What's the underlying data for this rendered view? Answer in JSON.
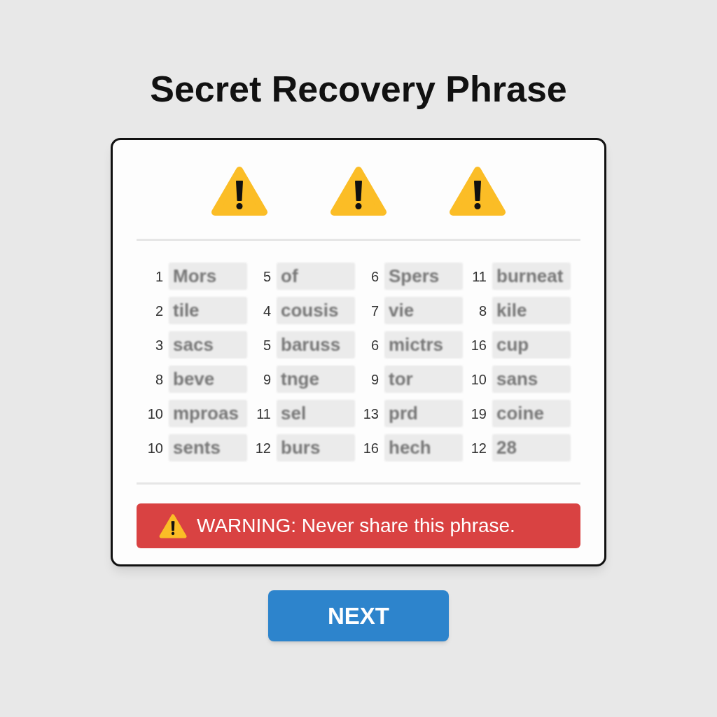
{
  "title": "Secret Recovery Phrase",
  "phrase": {
    "concealed": true,
    "words": [
      {
        "number": "1",
        "word": "Mors"
      },
      {
        "number": "5",
        "word": "of"
      },
      {
        "number": "6",
        "word": "Spers"
      },
      {
        "number": "11",
        "word": "burneat"
      },
      {
        "number": "2",
        "word": "tile"
      },
      {
        "number": "4",
        "word": "cousis"
      },
      {
        "number": "7",
        "word": "vie"
      },
      {
        "number": "8",
        "word": "kile"
      },
      {
        "number": "3",
        "word": "sacs"
      },
      {
        "number": "5",
        "word": "baruss"
      },
      {
        "number": "6",
        "word": "mictrs"
      },
      {
        "number": "16",
        "word": "cup"
      },
      {
        "number": "8",
        "word": "beve"
      },
      {
        "number": "9",
        "word": "tnge"
      },
      {
        "number": "9",
        "word": "tor"
      },
      {
        "number": "10",
        "word": "sans"
      },
      {
        "number": "10",
        "word": "mproas"
      },
      {
        "number": "11",
        "word": "sel"
      },
      {
        "number": "13",
        "word": "prd"
      },
      {
        "number": "19",
        "word": "coine"
      },
      {
        "number": "10",
        "word": "sents"
      },
      {
        "number": "12",
        "word": "burs"
      },
      {
        "number": "16",
        "word": "hech"
      },
      {
        "number": "12",
        "word": "28"
      }
    ]
  },
  "warning": {
    "text": "WARNING: Never share this phrase."
  },
  "next_button": {
    "label": "NEXT"
  }
}
